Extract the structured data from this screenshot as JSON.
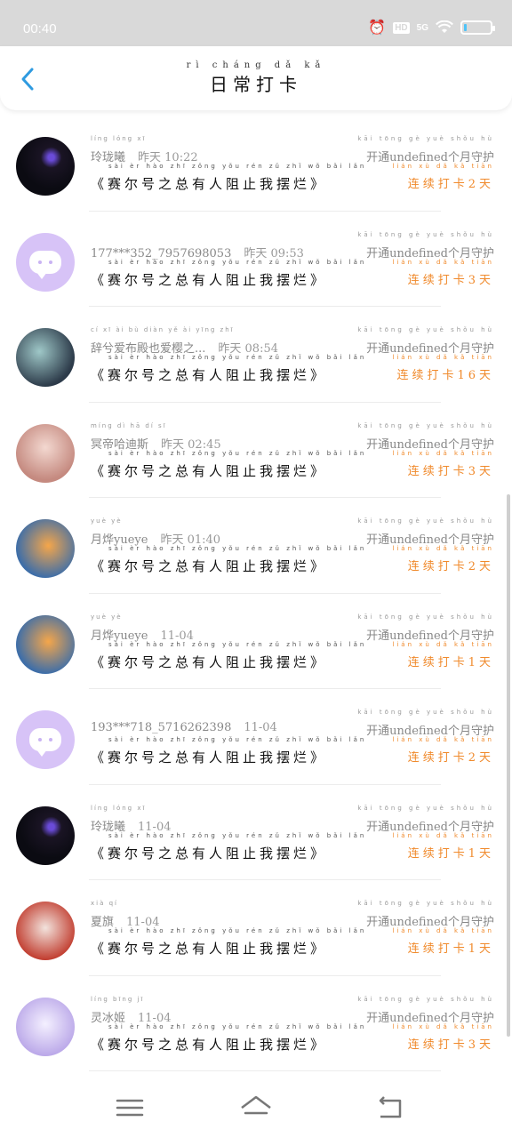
{
  "status_bar": {
    "time": "00:40",
    "hd": "HD",
    "network": "5G",
    "battery_level": 0.12
  },
  "header": {
    "title": "日常打卡",
    "title_pinyin": "rì cháng dǎ kǎ"
  },
  "common": {
    "book_title": "《赛尔号之总有人阻止我摆烂》",
    "book_pinyin": "sài èr hào zhī zǒng yǒu rén zǔ zhǐ wǒ bǎi lǎn",
    "open_text": "开通undefined个月守护",
    "open_pinyin": "kāi tōng                    gè yuè shǒu hù"
  },
  "rows": [
    {
      "name": "玲珑曦",
      "name_pinyin": "líng lóng xī",
      "time": "昨天 10:22",
      "time_pinyin": "zuó tiān",
      "streak": "连续打卡2天",
      "streak_pinyin": "lián xù dǎ kǎ tiān",
      "avatar": "dark-avatar"
    },
    {
      "name": "177***352_7957698053",
      "name_pinyin": "",
      "time": "昨天 09:53",
      "time_pinyin": "zuó tiān",
      "streak": "连续打卡3天",
      "streak_pinyin": "lián xù dǎ kǎ tiān",
      "avatar": "default-avatar"
    },
    {
      "name": "辞兮爱布殿也爱樱之...",
      "name_pinyin": "cí xī ài bù diàn yě ài yīng zhī",
      "time": "昨天 08:54",
      "time_pinyin": "zuó tiān",
      "streak": "连续打卡16天",
      "streak_pinyin": "lián xù dǎ kǎ tiān",
      "avatar": "anime-avatar-1"
    },
    {
      "name": "冥帝哈迪斯",
      "name_pinyin": "míng dì hā dí sī",
      "time": "昨天 02:45",
      "time_pinyin": "zuó tiān",
      "streak": "连续打卡3天",
      "streak_pinyin": "lián xù dǎ kǎ tiān",
      "avatar": "anime-avatar-2"
    },
    {
      "name": "月烨yueye",
      "name_pinyin": "yuè yè",
      "time": "昨天 01:40",
      "time_pinyin": "zuó tiān",
      "streak": "连续打卡2天",
      "streak_pinyin": "lián xù dǎ kǎ tiān",
      "avatar": "anime-avatar-3"
    },
    {
      "name": "月烨yueye",
      "name_pinyin": "yuè yè",
      "time": "11-04",
      "time_pinyin": "",
      "streak": "连续打卡1天",
      "streak_pinyin": "lián xù dǎ kǎ tiān",
      "avatar": "anime-avatar-3"
    },
    {
      "name": "193***718_5716262398",
      "name_pinyin": "",
      "time": "11-04",
      "time_pinyin": "",
      "streak": "连续打卡2天",
      "streak_pinyin": "lián xù dǎ kǎ tiān",
      "avatar": "default-avatar"
    },
    {
      "name": "玲珑曦",
      "name_pinyin": "líng lóng xī",
      "time": "11-04",
      "time_pinyin": "",
      "streak": "连续打卡1天",
      "streak_pinyin": "lián xù dǎ kǎ tiān",
      "avatar": "dark-avatar"
    },
    {
      "name": "夏旗",
      "name_pinyin": "xià qí",
      "time": "11-04",
      "time_pinyin": "",
      "streak": "连续打卡1天",
      "streak_pinyin": "lián xù dǎ kǎ tiān",
      "avatar": "anime-avatar-4"
    },
    {
      "name": "灵冰姬",
      "name_pinyin": "líng bīng jī",
      "time": "11-04",
      "time_pinyin": "",
      "streak": "连续打卡3天",
      "streak_pinyin": "lián xù dǎ kǎ tiān",
      "avatar": "anime-avatar-5"
    }
  ],
  "nav": {
    "menu_icon": "menu-icon",
    "home_icon": "home-icon",
    "back_icon": "back-icon"
  },
  "colors": {
    "accent": "#2f9be0",
    "streak": "#f08a2c",
    "default_avatar": "#d7c3f7"
  }
}
